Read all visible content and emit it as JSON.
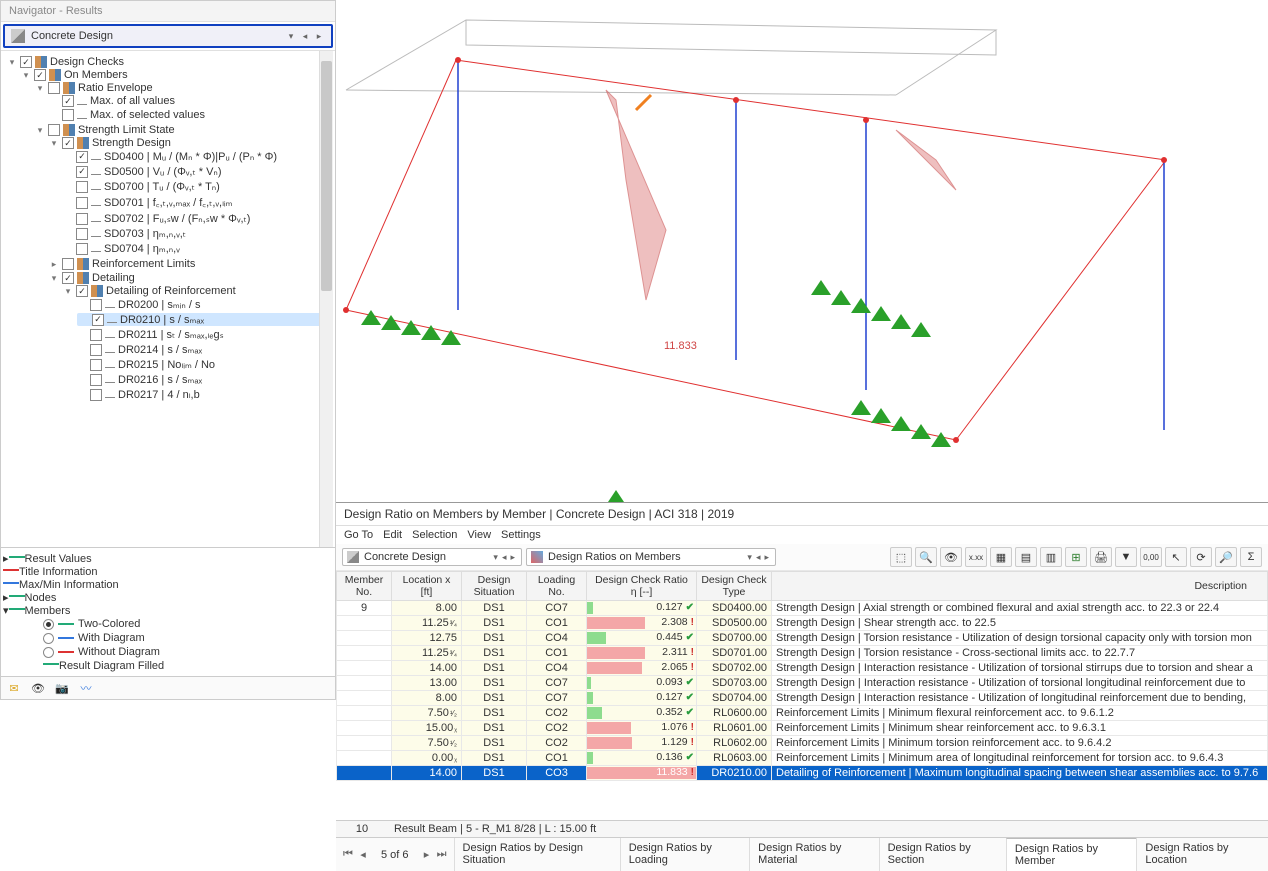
{
  "navigator": {
    "title": "Navigator - Results",
    "selector": "Concrete Design",
    "tree": {
      "root": "Design Checks",
      "on_members": "On Members",
      "ratio_env": "Ratio Envelope",
      "max_all": "Max. of all values",
      "max_sel": "Max. of selected values",
      "sls": "Strength Limit State",
      "sd": "Strength Design",
      "sd400": "SD0400 | Mᵤ / (Mₙ * Φ)|Pᵤ / (Pₙ * Φ)",
      "sd500": "SD0500 | Vᵤ / (Φᵥ,ₜ * Vₙ)",
      "sd700": "SD0700 | Tᵤ / (Φᵥ,ₜ * Tₙ)",
      "sd701": "SD0701 | f꜀,ₜ,ᵥ,ₘₐₓ / f꜀,ₜ,ᵥ,ₗᵢₘ",
      "sd702": "SD0702 | Fᵤ,ₛw / (Fₙ,ₛw * Φᵥ,ₜ)",
      "sd703": "SD0703 | ηₘ,ₙ,ᵥ,ₜ",
      "sd704": "SD0704 | ηₘ,ₙ,ᵥ",
      "reinf_limits": "Reinforcement Limits",
      "detailing": "Detailing",
      "dor": "Detailing of Reinforcement",
      "dr0200": "DR0200 | sₘᵢₙ / s",
      "dr0210": "DR0210 | s / sₘₐₓ",
      "dr0211": "DR0211 | sₜ / sₘₐₓ,ₗₑgₛ",
      "dr0214": "DR0214 | s / sₘₐₓ",
      "dr0215": "DR0215 | Noₗᵢₘ / No",
      "dr0216": "DR0216 | s / sₘₐₓ",
      "dr0217": "DR0217 | 4 / nₗ,b"
    },
    "bottom_items": {
      "result_values": "Result Values",
      "title_info": "Title Information",
      "maxmin": "Max/Min Information",
      "nodes": "Nodes",
      "members": "Members",
      "two_colored": "Two-Colored",
      "with_diagram": "With Diagram",
      "without_diagram": "Without Diagram",
      "result_diagram_filled": "Result Diagram Filled"
    }
  },
  "viewport": {
    "max_label": "11.833"
  },
  "grid": {
    "title": "Design Ratio on Members by Member | Concrete Design | ACI 318 | 2019",
    "menu": {
      "goto": "Go To",
      "edit": "Edit",
      "selection": "Selection",
      "view": "View",
      "settings": "Settings"
    },
    "combo1": "Concrete Design",
    "combo2": "Design Ratios on Members",
    "headers": {
      "member_no": "Member No.",
      "location": "Location x [ft]",
      "ds": "Design Situation",
      "loading": "Loading No.",
      "ratio": "Design Check Ratio η [--]",
      "type": "Design Check Type",
      "desc": "Description"
    },
    "member_no": "9",
    "rows": [
      {
        "loc": "8.00",
        "frac": "",
        "ds": "DS1",
        "ln": "CO7",
        "ratio": 0.127,
        "ok": true,
        "code": "SD0400.00",
        "desc": "Strength Design | Axial strength or combined flexural and axial strength acc. to 22.3 or 22.4"
      },
      {
        "loc": "11.25",
        "frac": "³⁄₄",
        "ds": "DS1",
        "ln": "CO1",
        "ratio": 2.308,
        "ok": false,
        "code": "SD0500.00",
        "desc": "Strength Design | Shear strength acc. to 22.5"
      },
      {
        "loc": "12.75",
        "frac": "",
        "ds": "DS1",
        "ln": "CO4",
        "ratio": 0.445,
        "ok": true,
        "code": "SD0700.00",
        "desc": "Strength Design | Torsion resistance - Utilization of design torsional capacity only with torsion mon"
      },
      {
        "loc": "11.25",
        "frac": "³⁄₄",
        "ds": "DS1",
        "ln": "CO1",
        "ratio": 2.311,
        "ok": false,
        "code": "SD0701.00",
        "desc": "Strength Design | Torsion resistance - Cross-sectional limits acc. to 22.7.7"
      },
      {
        "loc": "14.00",
        "frac": "",
        "ds": "DS1",
        "ln": "CO4",
        "ratio": 2.065,
        "ok": false,
        "code": "SD0702.00",
        "desc": "Strength Design | Interaction resistance - Utilization of torsional stirrups due to torsion and shear a"
      },
      {
        "loc": "13.00",
        "frac": "",
        "ds": "DS1",
        "ln": "CO7",
        "ratio": 0.093,
        "ok": true,
        "code": "SD0703.00",
        "desc": "Strength Design | Interaction resistance - Utilization of torsional longitudinal reinforcement due to"
      },
      {
        "loc": "8.00",
        "frac": "",
        "ds": "DS1",
        "ln": "CO7",
        "ratio": 0.127,
        "ok": true,
        "code": "SD0704.00",
        "desc": "Strength Design | Interaction resistance - Utilization of longitudinal reinforcement due to bending,"
      },
      {
        "loc": "7.50",
        "frac": "¹⁄₂",
        "ds": "DS1",
        "ln": "CO2",
        "ratio": 0.352,
        "ok": true,
        "code": "RL0600.00",
        "desc": "Reinforcement Limits | Minimum flexural reinforcement acc. to 9.6.1.2"
      },
      {
        "loc": "15.00",
        "frac": "ᵪ",
        "ds": "DS1",
        "ln": "CO2",
        "ratio": 1.076,
        "ok": false,
        "code": "RL0601.00",
        "desc": "Reinforcement Limits | Minimum shear reinforcement acc. to 9.6.3.1"
      },
      {
        "loc": "7.50",
        "frac": "¹⁄₂",
        "ds": "DS1",
        "ln": "CO2",
        "ratio": 1.129,
        "ok": false,
        "code": "RL0602.00",
        "desc": "Reinforcement Limits | Minimum torsion reinforcement acc. to 9.6.4.2"
      },
      {
        "loc": "0.00",
        "frac": "ᵪ",
        "ds": "DS1",
        "ln": "CO1",
        "ratio": 0.136,
        "ok": true,
        "code": "RL0603.00",
        "desc": "Reinforcement Limits | Minimum area of longitudinal reinforcement for torsion acc. to 9.6.4.3"
      },
      {
        "loc": "14.00",
        "frac": "",
        "ds": "DS1",
        "ln": "CO3",
        "ratio": 11.833,
        "ok": false,
        "code": "DR0210.00",
        "desc": "Detailing of Reinforcement | Maximum longitudinal spacing between shear assemblies acc. to 9.7.6",
        "sel": true
      }
    ],
    "footer_left": "10",
    "footer_text": "Result Beam | 5 - R_M1 8/28 | L : 15.00 ft",
    "page": "5 of 6",
    "tabs": [
      "Design Ratios by Design Situation",
      "Design Ratios by Loading",
      "Design Ratios by Material",
      "Design Ratios by Section",
      "Design Ratios by Member",
      "Design Ratios by Location"
    ],
    "active_tab": 4
  }
}
